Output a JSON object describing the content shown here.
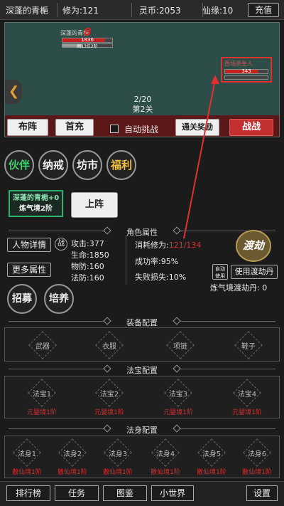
{
  "topbar": {
    "player_name": "深蓬的青梔",
    "cultivation": "修为:121",
    "spirit_coins": "灵币:2053",
    "fate": "仙缘:10",
    "recharge_label": "充值"
  },
  "scene": {
    "ally": {
      "name": "深蓬的青梔",
      "level": "8",
      "hp": "1836",
      "mp": "图13位2阶"
    },
    "enemy": {
      "name": "西场杀生人",
      "hp": "343"
    },
    "back_icon": "chevron-left-icon",
    "wave": "2/20",
    "stage": "第2关",
    "buttons": {
      "lineup": "布阵",
      "first_charge": "首充",
      "auto_label": "自动挑战",
      "clear_reward": "通关奖励",
      "fight": "战战"
    }
  },
  "nav_circles": [
    "伙伴",
    "纳戒",
    "坊市",
    "福利"
  ],
  "partner": {
    "card_name": "深蓬的青梔+0",
    "card_realm": "炼气境2阶",
    "deploy_label": "上阵"
  },
  "attributes": {
    "section_title": "角色属性",
    "detail_button": "人物详情",
    "battle_badge": "战",
    "more_button": "更多属性",
    "attack": "攻击:377",
    "hp": "生命:1850",
    "phys_def": "物防:160",
    "magic_def": "法防:160",
    "cost_label": "消耗修为:",
    "cost_value": "121/134",
    "success_rate": "成功率:95%",
    "fail_loss": "失败损失:10%",
    "tribulation_seal": "渡劫",
    "auto_use_label": "自动使用",
    "use_pill_button": "使用渡劫丹",
    "pill_count": "炼气境渡劫丹: 0"
  },
  "recruit": {
    "recruit": "招募",
    "train": "培养"
  },
  "equipment": {
    "section_title": "装备配置",
    "slots": [
      "武器",
      "衣服",
      "项链",
      "鞋子"
    ]
  },
  "treasure": {
    "section_title": "法宝配置",
    "slots": [
      {
        "name": "法宝1",
        "realm": "元婴境1阶"
      },
      {
        "name": "法宝2",
        "realm": "元婴境1阶"
      },
      {
        "name": "法宝3",
        "realm": "元婴境1阶"
      },
      {
        "name": "法宝4",
        "realm": "元婴境1阶"
      }
    ]
  },
  "dharma": {
    "section_title": "法身配置",
    "slots": [
      {
        "name": "法身1",
        "realm": "散仙境1阶"
      },
      {
        "name": "法身2",
        "realm": "散仙境1阶"
      },
      {
        "name": "法身3",
        "realm": "散仙境1阶"
      },
      {
        "name": "法身4",
        "realm": "散仙境1阶"
      },
      {
        "name": "法身5",
        "realm": "散仙境1阶"
      },
      {
        "name": "法身6",
        "realm": "散仙境1阶"
      }
    ]
  },
  "bottom_nav": {
    "leaderboard": "排行榜",
    "tasks": "任务",
    "codex": "图鉴",
    "small_world": "小世界",
    "settings": "设置"
  },
  "colors": {
    "scene_bg": "#2c4d48",
    "accent_red": "#d83030",
    "partner_green": "#2fb070",
    "fight_red": "#c23030"
  }
}
